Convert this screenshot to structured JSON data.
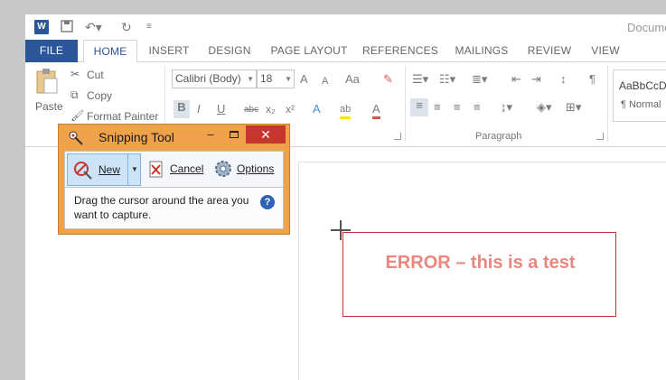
{
  "app": {
    "title": "Docume",
    "logo_letter": "W"
  },
  "tabs": [
    "FILE",
    "HOME",
    "INSERT",
    "DESIGN",
    "PAGE LAYOUT",
    "REFERENCES",
    "MAILINGS",
    "REVIEW",
    "VIEW"
  ],
  "clipboard": {
    "paste": "Paste",
    "cut": "Cut",
    "copy": "Copy",
    "format_painter": "Format Painter"
  },
  "font": {
    "name": "Calibri (Body)",
    "size": "18",
    "bold": "B",
    "italic": "I",
    "underline": "U",
    "strike": "abc",
    "subscript": "x₂",
    "superscript": "x²",
    "grow": "A",
    "shrink": "A",
    "case": "Aa",
    "text_effect": "A",
    "highlight": "ab",
    "font_color": "A"
  },
  "paragraph": {
    "label": "Paragraph",
    "show_marks": "¶"
  },
  "styles": {
    "style1": "AaBbCcD",
    "style1_name": "¶ Normal"
  },
  "snipping_tool": {
    "title": "Snipping Tool",
    "minimize": "–",
    "close": "✕",
    "new_label": "New",
    "cancel_label": "Cancel",
    "options_label": "Options",
    "message": "Drag the cursor around the area you want to capture.",
    "help": "?"
  },
  "document": {
    "text": "ERROR – this is a test"
  },
  "colors": {
    "word_blue": "#2b579a",
    "snip_frame": "#f0a24a",
    "close_red": "#c7362d",
    "error_text": "#e8867f",
    "selection_border": "#c0392b"
  },
  "icons": [
    "word-logo-icon",
    "save-icon",
    "undo-icon",
    "redo-icon",
    "customize-qat-icon",
    "scissors-icon",
    "copy-icon",
    "paintbrush-icon",
    "paste-icon",
    "clear-format-icon",
    "bullets-icon",
    "numbering-icon",
    "multilevel-icon",
    "decrease-indent-icon",
    "increase-indent-icon",
    "sort-icon",
    "align-left-icon",
    "center-icon",
    "align-right-icon",
    "justify-icon",
    "line-spacing-icon",
    "shading-icon",
    "borders-icon",
    "snip-app-icon",
    "new-snip-icon",
    "cancel-icon",
    "gear-icon",
    "help-icon",
    "crosshair-icon"
  ]
}
